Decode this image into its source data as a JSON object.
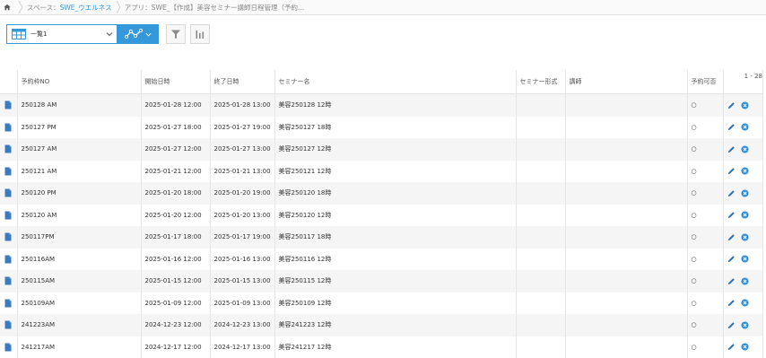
{
  "breadcrumb": {
    "space_prefix": "スペース：",
    "space_name": "SWE_ウエルネス",
    "app_label": "アプリ：SWE_【作成】美容セミナー講師日程管理（予約..."
  },
  "toolbar": {
    "view_name": "一覧1",
    "pager": "1 - 28"
  },
  "table": {
    "columns": [
      "予約枠NO",
      "開始日時",
      "終了日時",
      "セミナー名",
      "セミナー形式",
      "講師",
      "予約可否"
    ],
    "rows": [
      {
        "no": "250128 AM",
        "start": "2025-01-28 12:00",
        "end": "2025-01-28 13:00",
        "seminar": "美容250128 12時",
        "format": "",
        "teacher": "",
        "avail": "○"
      },
      {
        "no": "250127 PM",
        "start": "2025-01-27 18:00",
        "end": "2025-01-27 19:00",
        "seminar": "美容250127 18時",
        "format": "",
        "teacher": "",
        "avail": "○"
      },
      {
        "no": "250127 AM",
        "start": "2025-01-27 12:00",
        "end": "2025-01-27 13:00",
        "seminar": "美容250127 12時",
        "format": "",
        "teacher": "",
        "avail": "○"
      },
      {
        "no": "250121 AM",
        "start": "2025-01-21 12:00",
        "end": "2025-01-21 13:00",
        "seminar": "美容250121 12時",
        "format": "",
        "teacher": "",
        "avail": "○"
      },
      {
        "no": "250120 PM",
        "start": "2025-01-20 18:00",
        "end": "2025-01-20 19:00",
        "seminar": "美容250120 18時",
        "format": "",
        "teacher": "",
        "avail": "○"
      },
      {
        "no": "250120 AM",
        "start": "2025-01-20 12:00",
        "end": "2025-01-20 13:00",
        "seminar": "美容250120 12時",
        "format": "",
        "teacher": "",
        "avail": "○"
      },
      {
        "no": "250117PM",
        "start": "2025-01-17 18:00",
        "end": "2025-01-17 19:00",
        "seminar": "美容250117 18時",
        "format": "",
        "teacher": "",
        "avail": "○"
      },
      {
        "no": "250116AM",
        "start": "2025-01-16 12:00",
        "end": "2025-01-16 13:00",
        "seminar": "美容250116 12時",
        "format": "",
        "teacher": "",
        "avail": "○"
      },
      {
        "no": "250115AM",
        "start": "2025-01-15 12:00",
        "end": "2025-01-15 13:00",
        "seminar": "美容250115 12時",
        "format": "",
        "teacher": "",
        "avail": "○"
      },
      {
        "no": "250109AM",
        "start": "2025-01-09 12:00",
        "end": "2025-01-09 13:00",
        "seminar": "美容250109 12時",
        "format": "",
        "teacher": "",
        "avail": "○"
      },
      {
        "no": "241223AM",
        "start": "2024-12-23 12:00",
        "end": "2024-12-23 13:00",
        "seminar": "美容241223 12時",
        "format": "",
        "teacher": "",
        "avail": "○"
      },
      {
        "no": "241217AM",
        "start": "2024-12-17 12:00",
        "end": "2024-12-17 13:00",
        "seminar": "美容241217 12時",
        "format": "",
        "teacher": "",
        "avail": "○"
      }
    ]
  },
  "icons": {
    "home": "home-icon",
    "view_table": "table-view-icon",
    "graph": "graph-icon",
    "filter": "filter-icon",
    "chart": "bar-chart-icon",
    "record": "document-icon",
    "edit": "pencil-icon",
    "delete": "delete-icon"
  },
  "colors": {
    "accent": "#3498db",
    "row_odd": "#f5f5f5",
    "border": "#e3e3e3"
  }
}
